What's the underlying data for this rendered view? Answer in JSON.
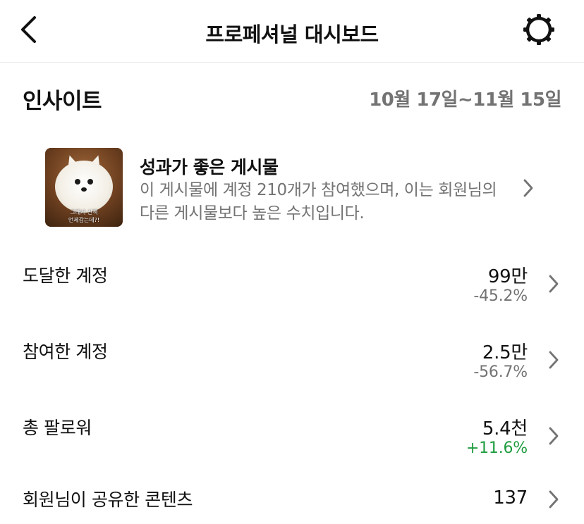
{
  "header": {
    "title": "프로페셔널 대시보드",
    "back_icon": "chevron-left-icon",
    "settings_icon": "gear-icon"
  },
  "insights": {
    "title": "인사이트",
    "date_range": "10월 17일~11월 15일"
  },
  "top_post": {
    "title": "성과가 좋은 게시물",
    "description": "이 게시물에 계정 210개가 참여했으며, 이는 회원님의 다른 게시물보다 높은 수치입니다.",
    "thumbnail_caption_line1": "그래서 산책",
    "thumbnail_caption_line2": "언제갑는데?!"
  },
  "metrics": [
    {
      "label": "도달한 계정",
      "value": "99만",
      "change": "-45.2%",
      "trend": "down"
    },
    {
      "label": "참여한 계정",
      "value": "2.5만",
      "change": "-56.7%",
      "trend": "down"
    },
    {
      "label": "총 팔로워",
      "value": "5.4천",
      "change": "+11.6%",
      "trend": "up"
    },
    {
      "label": "회원님이 공유한 콘텐츠",
      "value": "137",
      "change": "",
      "trend": "none"
    }
  ],
  "colors": {
    "muted_text": "#737373",
    "positive": "#1f9c3f",
    "divider": "#ececec"
  }
}
